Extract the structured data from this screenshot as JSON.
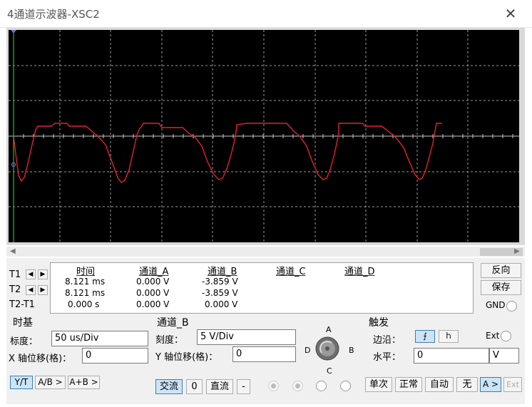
{
  "window": {
    "title": "4通道示波器-XSC2",
    "close_glyph": "✕"
  },
  "readout": {
    "columns": [
      "时间",
      "通道_A",
      "通道_B",
      "通道_C",
      "通道_D"
    ],
    "rows": [
      {
        "label": "T1",
        "time": "8.121 ms",
        "a": "0.000 V",
        "b": "-3.859 V"
      },
      {
        "label": "T2",
        "time": "8.121 ms",
        "a": "0.000 V",
        "b": "-3.859 V"
      },
      {
        "label": "T2-T1",
        "time": "0.000 s",
        "a": "0.000 V",
        "b": "0.000 V"
      }
    ]
  },
  "side_buttons": {
    "reverse": "反向",
    "save": "保存",
    "gnd": "GND"
  },
  "timebase": {
    "title": "时基",
    "scale_label": "标度：",
    "scale_value": "50 us/Div",
    "xpos_label": "X 轴位移(格)：",
    "xpos_value": "0",
    "modes": [
      "Y/T",
      "A/B >",
      "A+B >"
    ],
    "active_mode": "Y/T"
  },
  "channel": {
    "title": "通道_B",
    "scale_label": "刻度：",
    "scale_value": "5  V/Div",
    "ypos_label": "Y 轴位移(格)：",
    "ypos_value": "0",
    "coupling": [
      "交流",
      "0",
      "直流",
      "-"
    ],
    "active_coupling": "交流",
    "knob_labels": {
      "a": "A",
      "b": "B",
      "c": "C",
      "d": "D"
    }
  },
  "trigger": {
    "title": "触发",
    "edge_label": "边沿：",
    "ext_label": "Ext",
    "level_label": "水平：",
    "level_value": "0",
    "level_unit": "V",
    "modes": [
      "单次",
      "正常",
      "自动",
      "无"
    ],
    "source_buttons": [
      "A >",
      "Ext"
    ]
  },
  "colors": {
    "trace": "#e8202a",
    "grid": "#9a9a9a",
    "cursor": "#20c020",
    "screen_bg": "#000000",
    "active_btn": "#cce4f7"
  },
  "icons": {
    "rising_edge": "rising-edge-icon",
    "falling_edge": "falling-edge-icon",
    "knob": "channel-knob-icon"
  }
}
